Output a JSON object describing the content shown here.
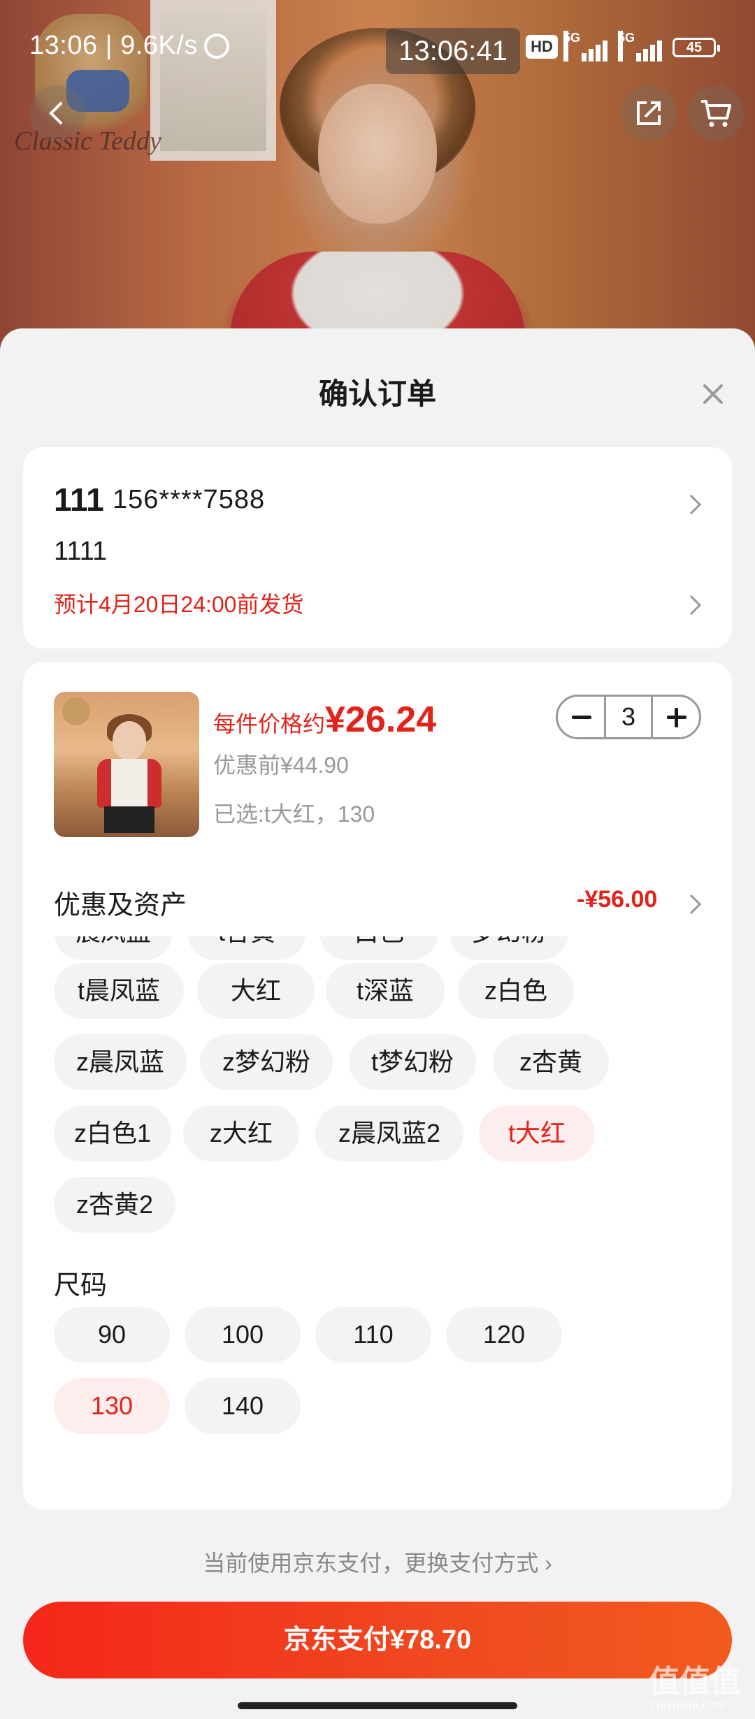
{
  "status_bar": {
    "time": "13:06",
    "speed": "9.6K/s",
    "clock": "13:06:41",
    "hd": "HD",
    "net1": "5G",
    "net2": "5G",
    "battery": "45"
  },
  "hero": {
    "brand": "Classic Teddy"
  },
  "sheet": {
    "title": "确认订单"
  },
  "address": {
    "name": "111",
    "phone": "156****7588",
    "detail": "1111",
    "ship_note": "预计4月20日24:00前发货"
  },
  "product": {
    "price_label": "每件价格约",
    "price": "¥26.24",
    "original_price": "优惠前¥44.90",
    "selected": "已选:t大红，130",
    "quantity": "3"
  },
  "promo": {
    "label": "优惠及资产",
    "value": "-¥56.00"
  },
  "colors": {
    "partial": [
      "晨凤蓝",
      "t杏黄",
      "白色",
      "梦幻粉"
    ],
    "options": [
      "t晨凤蓝",
      "大红",
      "t深蓝",
      "z白色",
      "z晨凤蓝",
      "z梦幻粉",
      "t梦幻粉",
      "z杏黄",
      "z白色1",
      "z大红",
      "z晨凤蓝2",
      "t大红",
      "z杏黄2"
    ],
    "selected": "t大红"
  },
  "sizes": {
    "label": "尺码",
    "options": [
      "90",
      "100",
      "110",
      "120",
      "130",
      "140"
    ],
    "selected": "130"
  },
  "payment": {
    "note": "当前使用京东支付，更换支付方式 ›",
    "button": "京东支付¥78.70"
  },
  "watermark": {
    "logo": "值值值",
    "site": "zhizhizhi.com"
  },
  "accent_color": "#e2231a"
}
